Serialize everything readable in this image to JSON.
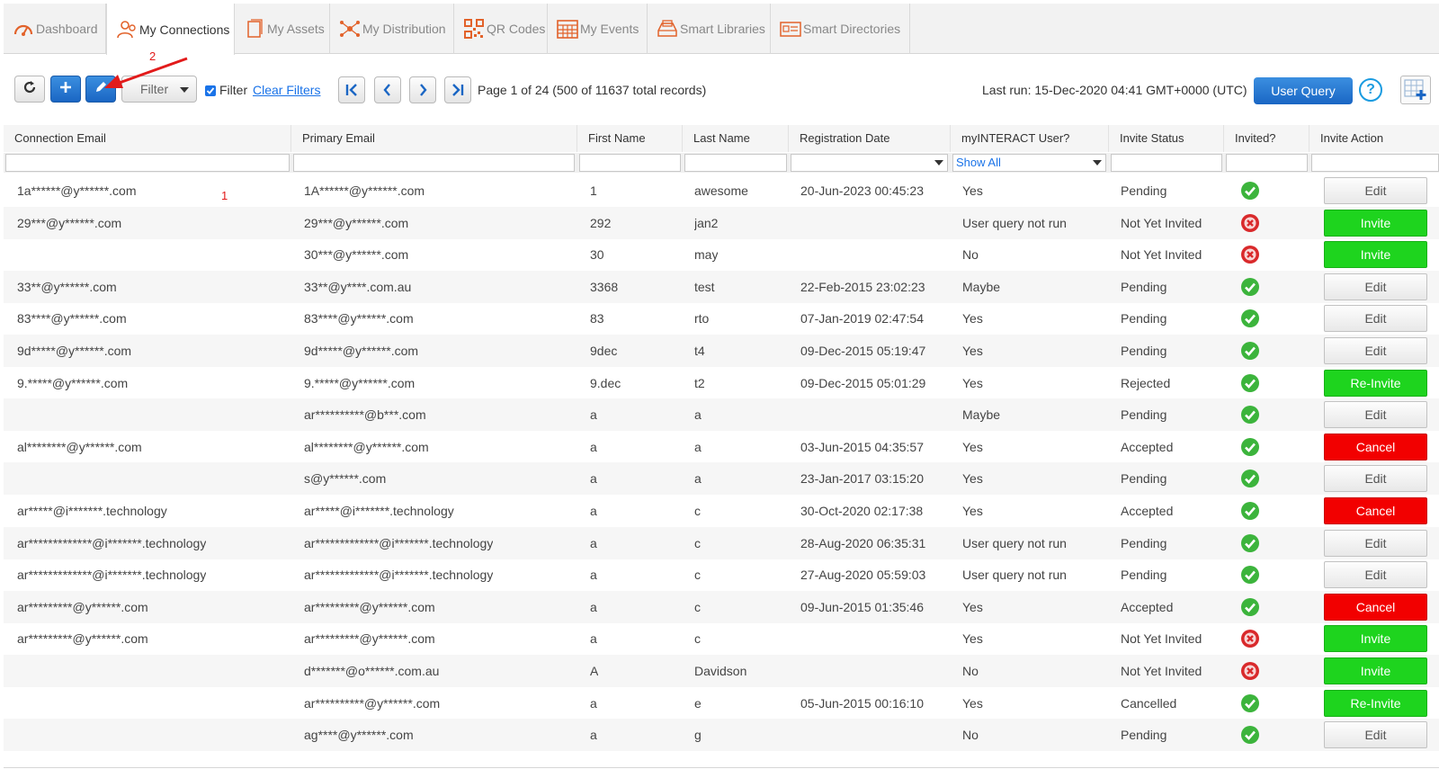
{
  "tabs": [
    {
      "label": "Dashboard",
      "icon": "dashboard-gauge-icon",
      "active": false
    },
    {
      "label": "My Connections",
      "icon": "connections-users-icon",
      "active": true
    },
    {
      "label": "My Assets",
      "icon": "assets-document-icon",
      "active": false
    },
    {
      "label": "My Distribution",
      "icon": "distribution-network-icon",
      "active": false
    },
    {
      "label": "QR Codes",
      "icon": "qr-code-icon",
      "active": false
    },
    {
      "label": "My Events",
      "icon": "events-calendar-icon",
      "active": false
    },
    {
      "label": "Smart Libraries",
      "icon": "library-icon",
      "active": false
    },
    {
      "label": "Smart Directories",
      "icon": "directory-icon",
      "active": false
    }
  ],
  "toolbar": {
    "filter_select": "Filter",
    "filter_checkbox_label": "Filter",
    "clear_filters": "Clear Filters",
    "page_info": "Page 1 of 24 (500 of 11637 total records)",
    "last_run": "Last run: 15-Dec-2020 04:41 GMT+0000 (UTC)",
    "user_query": "User Query",
    "help": "?"
  },
  "annotations": {
    "one": "1",
    "two": "2"
  },
  "columns": [
    "Connection Email",
    "Primary Email",
    "First Name",
    "Last Name",
    "Registration Date",
    "myINTERACT User?",
    "Invite Status",
    "Invited?",
    "Invite Action"
  ],
  "filters": {
    "myinteract_user": "Show All"
  },
  "rows": [
    {
      "conn": "1a******@y******.com",
      "primary": "1A******@y******.com",
      "first": "1",
      "last": "awesome",
      "reg": "20-Jun-2023 00:45:23",
      "user": "Yes",
      "status": "Pending",
      "invited": true,
      "action": "Edit"
    },
    {
      "conn": "29***@y******.com",
      "primary": "29***@y******.com",
      "first": "292",
      "last": "jan2",
      "reg": "",
      "user": "User query not run",
      "status": "Not Yet Invited",
      "invited": false,
      "action": "Invite"
    },
    {
      "conn": "",
      "primary": "30***@y******.com",
      "first": "30",
      "last": "may",
      "reg": "",
      "user": "No",
      "status": "Not Yet Invited",
      "invited": false,
      "action": "Invite"
    },
    {
      "conn": "33**@y******.com",
      "primary": "33**@y****.com.au",
      "first": "3368",
      "last": "test",
      "reg": "22-Feb-2015 23:02:23",
      "user": "Maybe",
      "status": "Pending",
      "invited": true,
      "action": "Edit"
    },
    {
      "conn": "83****@y******.com",
      "primary": "83****@y******.com",
      "first": "83",
      "last": "rto",
      "reg": "07-Jan-2019 02:47:54",
      "user": "Yes",
      "status": "Pending",
      "invited": true,
      "action": "Edit"
    },
    {
      "conn": "9d*****@y******.com",
      "primary": "9d*****@y******.com",
      "first": "9dec",
      "last": "t4",
      "reg": "09-Dec-2015 05:19:47",
      "user": "Yes",
      "status": "Pending",
      "invited": true,
      "action": "Edit"
    },
    {
      "conn": "9.*****@y******.com",
      "primary": "9.*****@y******.com",
      "first": "9.dec",
      "last": "t2",
      "reg": "09-Dec-2015 05:01:29",
      "user": "Yes",
      "status": "Rejected",
      "invited": true,
      "action": "Re-Invite"
    },
    {
      "conn": "",
      "primary": "ar**********@b***.com",
      "first": "a",
      "last": "a",
      "reg": "",
      "user": "Maybe",
      "status": "Pending",
      "invited": true,
      "action": "Edit"
    },
    {
      "conn": "al********@y******.com",
      "primary": "al********@y******.com",
      "first": "a",
      "last": "a",
      "reg": "03-Jun-2015 04:35:57",
      "user": "Yes",
      "status": "Accepted",
      "invited": true,
      "action": "Cancel"
    },
    {
      "conn": "",
      "primary": "s@y******.com",
      "first": "a",
      "last": "a",
      "reg": "23-Jan-2017 03:15:20",
      "user": "Yes",
      "status": "Pending",
      "invited": true,
      "action": "Edit"
    },
    {
      "conn": "ar*****@i*******.technology",
      "primary": "ar*****@i*******.technology",
      "first": "a",
      "last": "c",
      "reg": "30-Oct-2020 02:17:38",
      "user": "Yes",
      "status": "Accepted",
      "invited": true,
      "action": "Cancel"
    },
    {
      "conn": "ar*************@i*******.technology",
      "primary": "ar*************@i*******.technology",
      "first": "a",
      "last": "c",
      "reg": "28-Aug-2020 06:35:31",
      "user": "User query not run",
      "status": "Pending",
      "invited": true,
      "action": "Edit"
    },
    {
      "conn": "ar*************@i*******.technology",
      "primary": "ar*************@i*******.technology",
      "first": "a",
      "last": "c",
      "reg": "27-Aug-2020 05:59:03",
      "user": "User query not run",
      "status": "Pending",
      "invited": true,
      "action": "Edit"
    },
    {
      "conn": "ar*********@y******.com",
      "primary": "ar*********@y******.com",
      "first": "a",
      "last": "c",
      "reg": "09-Jun-2015 01:35:46",
      "user": "Yes",
      "status": "Accepted",
      "invited": true,
      "action": "Cancel"
    },
    {
      "conn": "ar*********@y******.com",
      "primary": "ar*********@y******.com",
      "first": "a",
      "last": "c",
      "reg": "",
      "user": "Yes",
      "status": "Not Yet Invited",
      "invited": false,
      "action": "Invite"
    },
    {
      "conn": "",
      "primary": "d*******@o******.com.au",
      "first": "A",
      "last": "Davidson",
      "reg": "",
      "user": "No",
      "status": "Not Yet Invited",
      "invited": false,
      "action": "Invite"
    },
    {
      "conn": "",
      "primary": "ar**********@y******.com",
      "first": "a",
      "last": "e",
      "reg": "05-Jun-2015 00:16:10",
      "user": "Yes",
      "status": "Cancelled",
      "invited": true,
      "action": "Re-Invite"
    },
    {
      "conn": "",
      "primary": "ag****@y******.com",
      "first": "a",
      "last": "g",
      "reg": "",
      "user": "No",
      "status": "Pending",
      "invited": true,
      "action": "Edit"
    }
  ],
  "colors": {
    "accent": "#1a73e8",
    "invite_green": "#1ed41e",
    "cancel_red": "#f20000",
    "check_green": "#3cb43c",
    "cross_red": "#d9292b"
  }
}
